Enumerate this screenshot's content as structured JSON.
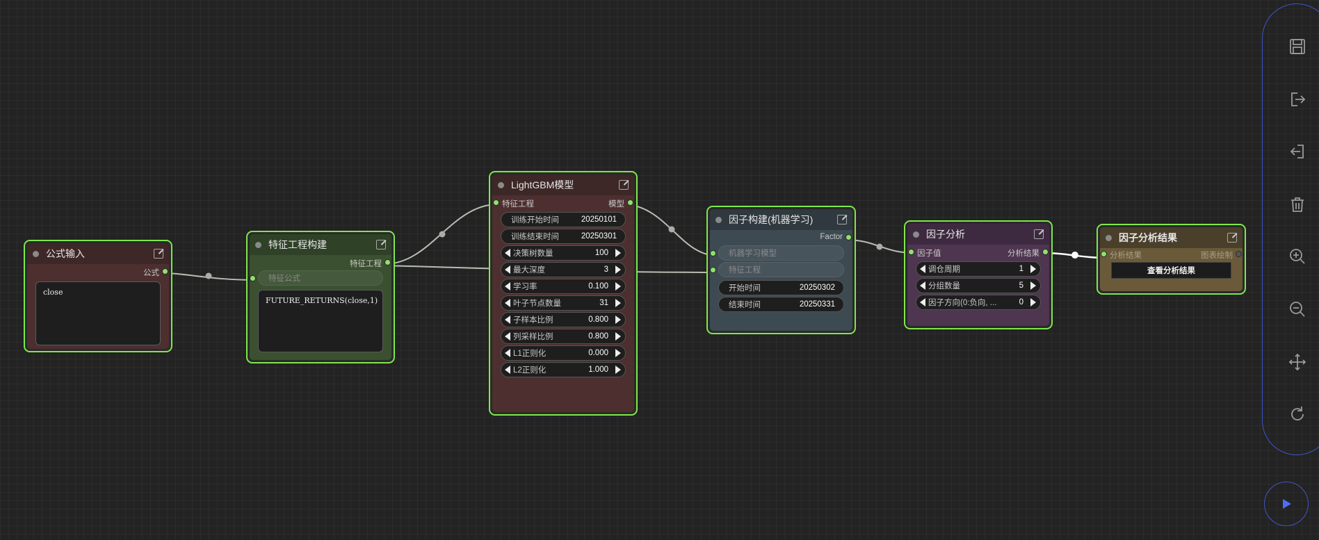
{
  "colors": {
    "canvas_bg": "#232323",
    "node_border_selected": "#7fe84a",
    "link": "#b8beb3",
    "slot_dot": "#8ee36a",
    "toolbar_border": "#3f56c4",
    "run_icon": "#4f6df5"
  },
  "nodes": {
    "formula_input": {
      "title": "公式输入",
      "output_label": "公式",
      "text": "close"
    },
    "feature_eng": {
      "title": "特征工程构建",
      "output_label": "特征工程",
      "input_label": "特征公式",
      "text": "FUTURE_RETURNS(close,1)"
    },
    "lightgbm": {
      "title": "LightGBM模型",
      "input_label": "特征工程",
      "output_label": "模型",
      "fields": [
        {
          "label": "训练开始时间",
          "value": "20250101",
          "kind": "text"
        },
        {
          "label": "训练结束时间",
          "value": "20250301",
          "kind": "text"
        },
        {
          "label": "决策树数量",
          "value": "100",
          "kind": "number"
        },
        {
          "label": "最大深度",
          "value": "3",
          "kind": "number"
        },
        {
          "label": "学习率",
          "value": "0.100",
          "kind": "number"
        },
        {
          "label": "叶子节点数量",
          "value": "31",
          "kind": "number"
        },
        {
          "label": "子样本比例",
          "value": "0.800",
          "kind": "number"
        },
        {
          "label": "列采样比例",
          "value": "0.800",
          "kind": "number"
        },
        {
          "label": "L1正则化",
          "value": "0.000",
          "kind": "number"
        },
        {
          "label": "L2正则化",
          "value": "1.000",
          "kind": "number"
        }
      ]
    },
    "factor_build": {
      "title": "因子构建(机器学习)",
      "output_label": "Factor",
      "input1_label": "机器学习模型",
      "input2_label": "特征工程",
      "fields": [
        {
          "label": "开始时间",
          "value": "20250302"
        },
        {
          "label": "结束时间",
          "value": "20250331"
        }
      ]
    },
    "factor_analysis": {
      "title": "因子分析",
      "input_label": "因子值",
      "output_label": "分析结果",
      "fields": [
        {
          "label": "调仓周期",
          "value": "1"
        },
        {
          "label": "分组数量",
          "value": "5"
        },
        {
          "label": "因子方向(0:负向, ...",
          "value": "0"
        }
      ]
    },
    "factor_result": {
      "title": "因子分析结果",
      "input_label": "分析结果",
      "output_label": "图表绘制",
      "button": "查看分析结果"
    }
  },
  "toolbar": {
    "icons": [
      "save-icon",
      "export-icon",
      "import-icon",
      "trash-icon",
      "zoom-in-icon",
      "zoom-out-icon",
      "move-icon",
      "refresh-icon"
    ],
    "run_icon": "play-icon"
  }
}
